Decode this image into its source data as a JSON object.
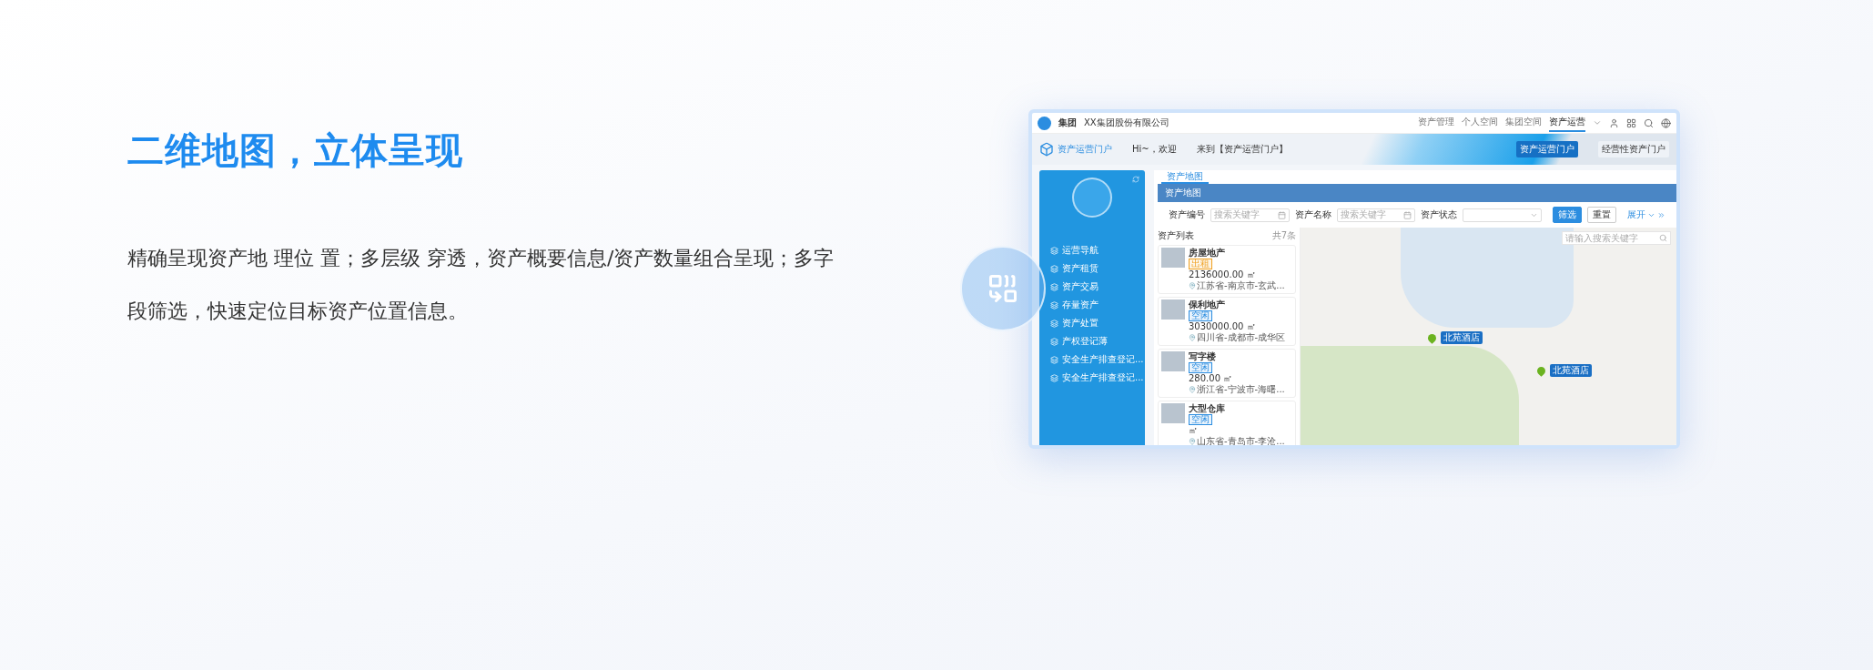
{
  "heading": "二维地图，立体呈现",
  "description": "精确呈现资产地 理位 置；多层级 穿透，资产概要信息/资产数量组合呈现；多字段筛选，快速定位目标资产位置信息。",
  "app": {
    "header": {
      "group": "集团",
      "company": "XX集团股份有限公司",
      "nav": [
        {
          "label": "资产管理",
          "selected": false
        },
        {
          "label": "个人空间",
          "selected": false
        },
        {
          "label": "集团空间",
          "selected": false
        },
        {
          "label": "资产运营",
          "selected": true
        }
      ]
    },
    "banner": {
      "portal": "资产运营门户",
      "greeting": "Hi~，欢迎",
      "welcome": "来到【资产运营门户】",
      "tabs": [
        {
          "label": "资产运营门户",
          "selected": true
        },
        {
          "label": "经营性资产门户",
          "selected": false
        }
      ]
    },
    "sidebar": {
      "items": [
        "运营导航",
        "资产租赁",
        "资产交易",
        "存量资产",
        "资产处置",
        "产权登记薄",
        "安全生产排查登记...",
        "安全生产排查登记..."
      ]
    },
    "page_tabs": [
      {
        "label": "资产地图",
        "selected": true
      }
    ],
    "title": "资产地图",
    "filters": [
      {
        "label": "资产编号",
        "placeholder": "搜索关键字",
        "kind": "text"
      },
      {
        "label": "资产名称",
        "placeholder": "搜索关键字",
        "kind": "text"
      },
      {
        "label": "资产状态",
        "kind": "select"
      }
    ],
    "buttons": [
      {
        "label": "筛选",
        "kind": "primary"
      },
      {
        "label": "重置",
        "kind": "plain"
      },
      {
        "label": "展开",
        "kind": "link"
      }
    ],
    "list": {
      "title": "资产列表",
      "count": "共7条",
      "cards": [
        {
          "name": "房屋地产",
          "status": "出租",
          "color": "#f0a020",
          "area": "2136000.00 ㎡",
          "location": "江苏省-南京市-玄武..."
        },
        {
          "name": "保利地产",
          "status": "空闲",
          "color": "#2b8de0",
          "area": "3030000.00 ㎡",
          "location": "四川省-成都市-成华区"
        },
        {
          "name": "写字楼",
          "status": "空闲",
          "color": "#2b8de0",
          "area": "280.00 ㎡",
          "location": "浙江省-宁波市-海曙..."
        },
        {
          "name": "大型仓库",
          "status": "空闲",
          "color": "#2b8de0",
          "area": "㎡",
          "location": "山东省-青岛市-李沧..."
        }
      ]
    },
    "map": {
      "search_placeholder": "请输入搜索关键字",
      "markers": [
        "北苑酒店",
        "北苑酒店"
      ]
    }
  }
}
